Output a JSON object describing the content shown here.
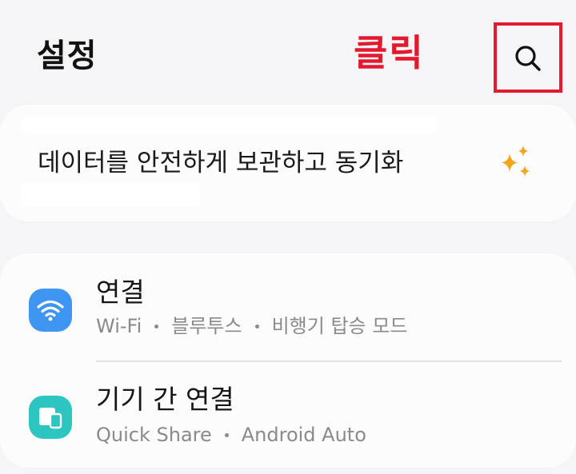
{
  "header": {
    "title": "설정",
    "annotation": "클릭",
    "search_icon": "search-icon",
    "annotation_color": "#e3192e"
  },
  "sync_card": {
    "text": "데이터를 안전하게 보관하고 동기화",
    "icon": "sparkle-icon",
    "icon_color": "#f3a51d"
  },
  "menu": {
    "items": [
      {
        "title": "연결",
        "subtitle": [
          "Wi-Fi",
          "블루투스",
          "비행기 탑승 모드"
        ],
        "icon": "wifi-icon",
        "icon_color": "#3e95f2"
      },
      {
        "title": "기기 간 연결",
        "subtitle": [
          "Quick Share",
          "Android Auto"
        ],
        "icon": "device-connection-icon",
        "icon_color": "#2dc5c0"
      }
    ]
  }
}
